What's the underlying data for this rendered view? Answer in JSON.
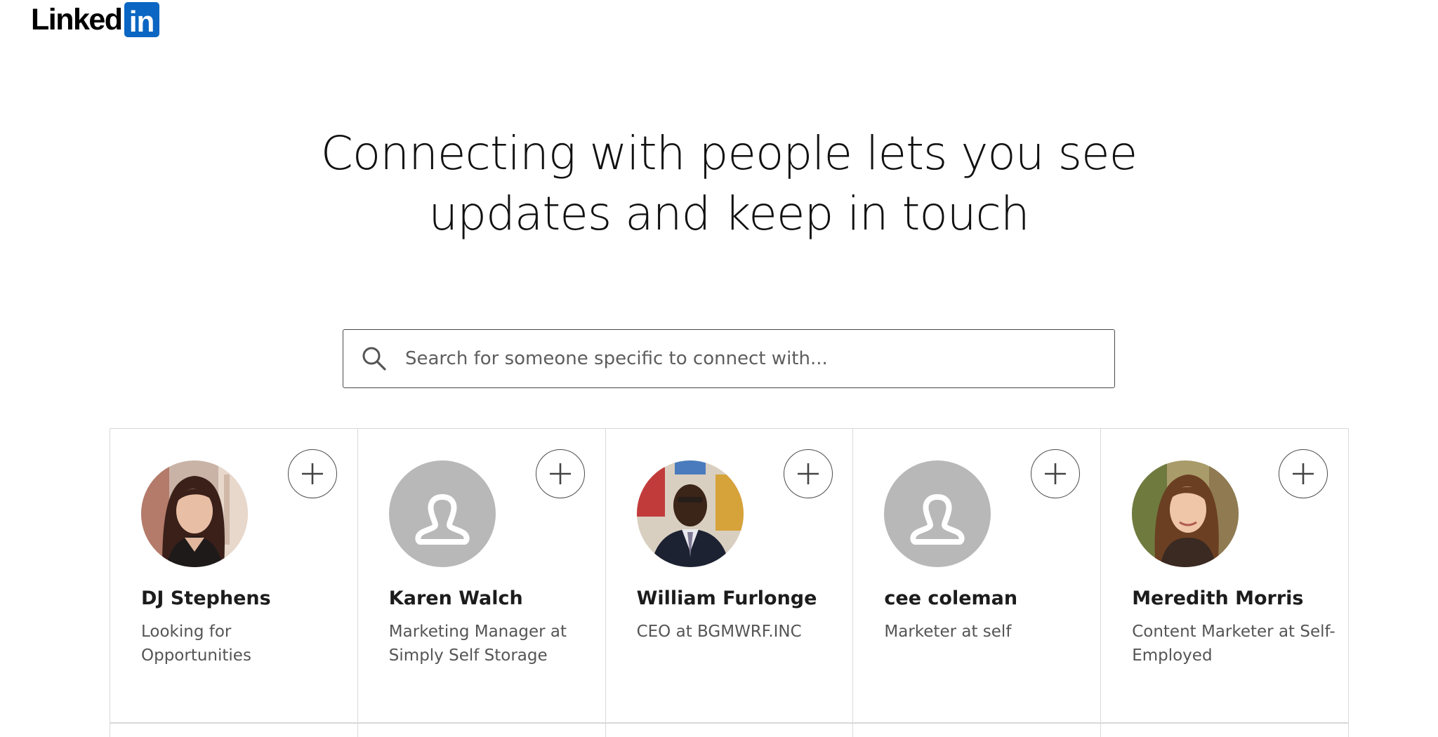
{
  "logo": {
    "word": "Linked",
    "box": "in",
    "brand_color": "#0a66c2"
  },
  "headline": {
    "line1": "Connecting with people lets you see",
    "line2": "updates and keep in touch"
  },
  "search": {
    "placeholder": "Search for someone specific to connect with...",
    "icon": "search-icon"
  },
  "cards": [
    {
      "name": "DJ Stephens",
      "headline": "Looking for Opportunities",
      "avatar": "photo",
      "action_icon": "plus-icon"
    },
    {
      "name": "Karen Walch",
      "headline": "Marketing Manager at Simply Self Storage",
      "avatar": "placeholder",
      "action_icon": "plus-icon"
    },
    {
      "name": "William Furlonge",
      "headline": "CEO at BGMWRF.INC",
      "avatar": "photo",
      "action_icon": "plus-icon"
    },
    {
      "name": "cee coleman",
      "headline": "Marketer at self",
      "avatar": "placeholder",
      "action_icon": "plus-icon"
    },
    {
      "name": "Meredith Morris",
      "headline": "Content Marketer at Self-Employed",
      "avatar": "photo",
      "action_icon": "plus-icon"
    }
  ]
}
